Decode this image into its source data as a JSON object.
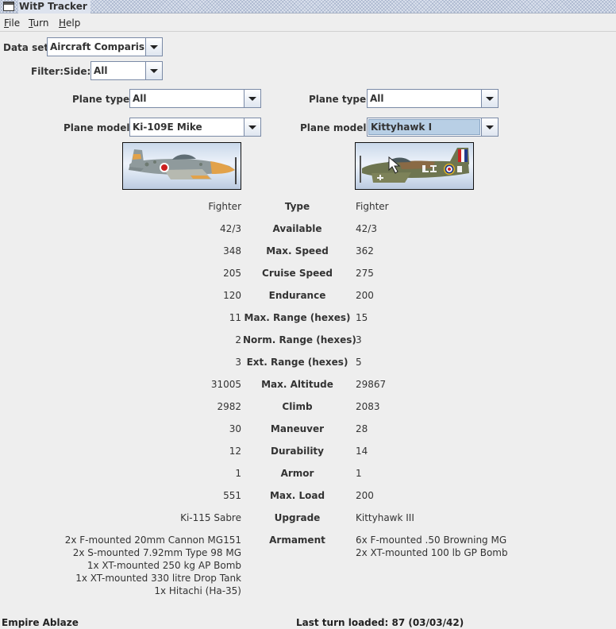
{
  "window": {
    "title": "WitP Tracker"
  },
  "menu": [
    {
      "name": "menu-file",
      "label": "File",
      "mnemonic": "F",
      "rest": "ile"
    },
    {
      "name": "menu-turn",
      "label": "Turn",
      "mnemonic": "T",
      "rest": "urn"
    },
    {
      "name": "menu-help",
      "label": "Help",
      "mnemonic": "H",
      "rest": "elp"
    }
  ],
  "dataset": {
    "label": "Data set:",
    "value": "Aircraft Comparison"
  },
  "filter": {
    "label": "Filter:",
    "side_label": "Side:",
    "side_value": "All"
  },
  "left": {
    "plane_type_label": "Plane type:",
    "plane_type": "All",
    "plane_model_label": "Plane model:",
    "plane_model": "Ki-109E Mike",
    "image_icon": "bf109-aircraft-image"
  },
  "right": {
    "plane_type_label": "Plane type:",
    "plane_type": "All",
    "plane_model_label": "Plane model:",
    "plane_model": "Kittyhawk I",
    "image_icon": "p40-aircraft-image"
  },
  "rows": [
    {
      "label": "Type",
      "left": "Fighter",
      "right": "Fighter"
    },
    {
      "label": "Available",
      "left": "42/3",
      "right": "42/3"
    },
    {
      "label": "Max. Speed",
      "left": "348",
      "right": "362"
    },
    {
      "label": "Cruise Speed",
      "left": "205",
      "right": "275"
    },
    {
      "label": "Endurance",
      "left": "120",
      "right": "200"
    },
    {
      "label": "Max. Range (hexes)",
      "left": "11",
      "right": "15"
    },
    {
      "label": "Norm. Range (hexes)",
      "left": "2",
      "right": "3"
    },
    {
      "label": "Ext. Range (hexes)",
      "left": "3",
      "right": "5"
    },
    {
      "label": "Max. Altitude",
      "left": "31005",
      "right": "29867"
    },
    {
      "label": "Climb",
      "left": "2982",
      "right": "2083"
    },
    {
      "label": "Maneuver",
      "left": "30",
      "right": "28"
    },
    {
      "label": "Durability",
      "left": "12",
      "right": "14"
    },
    {
      "label": "Armor",
      "left": "1",
      "right": "1"
    },
    {
      "label": "Max. Load",
      "left": "551",
      "right": "200"
    },
    {
      "label": "Upgrade",
      "left": "Ki-115 Sabre",
      "right": "Kittyhawk III"
    }
  ],
  "armament": {
    "label": "Armament",
    "left": [
      "2x F-mounted 20mm Cannon MG151",
      "2x S-mounted 7.92mm Type 98 MG",
      "1x XT-mounted 250 kg AP Bomb",
      "1x XT-mounted 330 litre Drop Tank",
      "1x Hitachi (Ha-35)"
    ],
    "right": [
      "6x F-mounted .50 Browning MG",
      "2x XT-mounted 100 lb GP Bomb"
    ]
  },
  "status": {
    "left": "Empire Ablaze",
    "last_turn": "Last turn loaded: 87 (03/03/42)"
  }
}
